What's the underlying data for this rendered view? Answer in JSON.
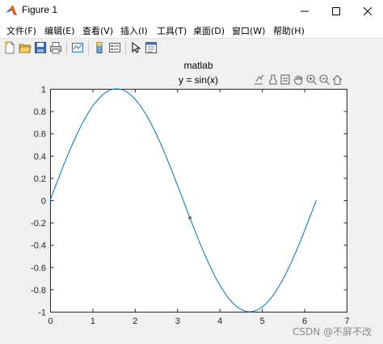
{
  "window": {
    "title": "Figure 1"
  },
  "menubar": {
    "items": [
      {
        "label": "文件(F)"
      },
      {
        "label": "编辑(E)"
      },
      {
        "label": "查看(V)"
      },
      {
        "label": "插入(I)"
      },
      {
        "label": "工具(T)"
      },
      {
        "label": "桌面(D)"
      },
      {
        "label": "窗口(W)"
      },
      {
        "label": "帮助(H)"
      }
    ]
  },
  "toolbar": {
    "buttons": [
      "new-figure-icon",
      "open-icon",
      "save-icon",
      "print-icon",
      "link-plot-icon",
      "insert-colorbar-icon",
      "insert-legend-icon",
      "edit-plot-icon",
      "property-inspector-icon"
    ]
  },
  "axes_toolbar": {
    "buttons": [
      "export-icon",
      "brush-icon",
      "data-tips-icon",
      "pan-icon",
      "zoom-in-icon",
      "zoom-out-icon",
      "home-icon"
    ]
  },
  "chart_data": {
    "type": "line",
    "title": "matlab",
    "subtitle": "y = sin(x)",
    "xlim": [
      0,
      7
    ],
    "ylim": [
      -1,
      1
    ],
    "xticks": [
      "0",
      "1",
      "2",
      "3",
      "4",
      "5",
      "6",
      "7"
    ],
    "yticks": [
      "-1",
      "-0.8",
      "-0.6",
      "-0.4",
      "-0.2",
      "0",
      "0.2",
      "0.4",
      "0.6",
      "0.8",
      "1"
    ],
    "series": [
      {
        "function": "sin",
        "x_start": 0,
        "x_end": 6.2832,
        "color": "#0072bd"
      }
    ],
    "marker": {
      "x": 3.3,
      "y": -0.158,
      "color": "#6b6b6b"
    },
    "grid": false
  },
  "watermark": "CSDN @不屏不改"
}
